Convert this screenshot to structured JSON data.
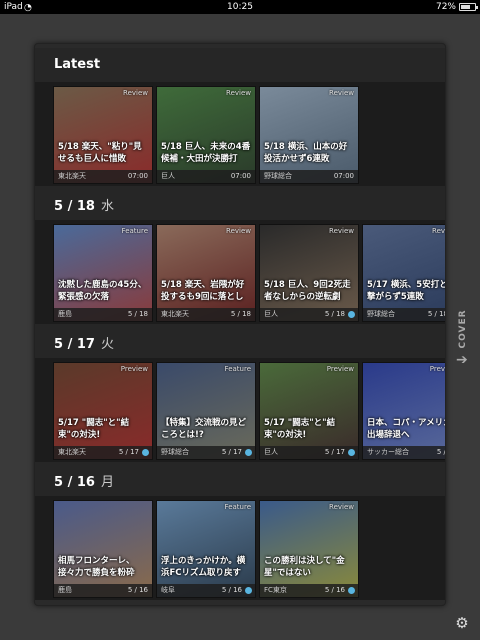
{
  "status_bar": {
    "device": "iPad",
    "time": "10:25",
    "battery": "72%",
    "battery_level": 0.72
  },
  "latest": {
    "title": "Latest",
    "cards": [
      {
        "tag": "Review",
        "caption": "5/18 楽天、\"粘り\"見せるも巨人に惜敗",
        "category": "東北楽天",
        "date": "07:00",
        "dot": false,
        "colors": [
          "#6b5a46",
          "#8a2a2a"
        ]
      },
      {
        "tag": "Review",
        "caption": "5/18 巨人、未来の4番候補・大田が決勝打",
        "category": "巨人",
        "date": "07:00",
        "dot": false,
        "colors": [
          "#3f6b3a",
          "#2a3a2a"
        ]
      },
      {
        "tag": "Review",
        "caption": "5/18 横浜、山本の好投活かせず6連敗",
        "category": "野球総合",
        "date": "07:00",
        "dot": false,
        "colors": [
          "#7a8a9a",
          "#4a5a6a"
        ]
      }
    ]
  },
  "sections": [
    {
      "date": "5 / 18",
      "dow": "水",
      "cards": [
        {
          "tag": "Feature",
          "caption": "沈黙した鹿島の45分、緊張感の欠落",
          "category": "鹿島",
          "date": "5 / 18",
          "dot": false,
          "colors": [
            "#4a6a9a",
            "#8a3a3a"
          ]
        },
        {
          "tag": "Review",
          "caption": "5/18 楽天、岩隈が好投するも9回に落とし",
          "category": "東北楽天",
          "date": "5 / 18",
          "dot": false,
          "colors": [
            "#8a6a5a",
            "#5a2020"
          ]
        },
        {
          "tag": "Review",
          "caption": "5/18 巨人、9回2死走者なしからの逆転劇",
          "category": "巨人",
          "date": "5 / 18",
          "dot": true,
          "colors": [
            "#2a2a2a",
            "#6a5a4a"
          ]
        },
        {
          "tag": "Review",
          "caption": "5/17 横浜、5安打と線撃がらず5連敗",
          "category": "野球総合",
          "date": "5 / 18",
          "dot": true,
          "colors": [
            "#4a5a7a",
            "#2a3a5a"
          ]
        }
      ]
    },
    {
      "date": "5 / 17",
      "dow": "火",
      "cards": [
        {
          "tag": "Preview",
          "caption": "5/17 \"闘志\"と\"結束\"の対決!",
          "category": "東北楽天",
          "date": "5 / 17",
          "dot": true,
          "colors": [
            "#5a3a2a",
            "#8a2a2a"
          ]
        },
        {
          "tag": "Feature",
          "caption": "【特集】交流戦の見どころとは!?",
          "category": "野球総合",
          "date": "5 / 17",
          "dot": true,
          "colors": [
            "#3a4a6a",
            "#6a6a5a"
          ]
        },
        {
          "tag": "Preview",
          "caption": "5/17 \"闘志\"と\"結束\"の対決!",
          "category": "巨人",
          "date": "5 / 17",
          "dot": true,
          "colors": [
            "#4a6a3a",
            "#3a2a2a"
          ]
        },
        {
          "tag": "Preview",
          "caption": "日本、コパ・アメリカ出場辞退へ",
          "category": "サッカー総合",
          "date": "5 / 17",
          "dot": false,
          "colors": [
            "#2a3a8a",
            "#5a6a9a"
          ]
        }
      ]
    },
    {
      "date": "5 / 16",
      "dow": "月",
      "cards": [
        {
          "tag": "",
          "caption": "相馬フロンターレ、接々力で勝負を粉砕",
          "category": "鹿島",
          "date": "5 / 16",
          "dot": false,
          "colors": [
            "#4a5a8a",
            "#8a6a4a"
          ]
        },
        {
          "tag": "Feature",
          "caption": "浮上のきっかけか。横浜FCリズム取り戻す",
          "category": "岐阜",
          "date": "5 / 16",
          "dot": true,
          "colors": [
            "#5a7a9a",
            "#2a3a4a"
          ]
        },
        {
          "tag": "Review",
          "caption": "この勝利は決して\"金星\"ではない",
          "category": "FC東京",
          "date": "5 / 16",
          "dot": true,
          "colors": [
            "#3a5a8a",
            "#8a8a3a"
          ]
        }
      ]
    }
  ],
  "cover_tab": {
    "label": "COVER",
    "icon": "arrow-right-icon"
  },
  "settings": {
    "icon": "gear-icon"
  }
}
